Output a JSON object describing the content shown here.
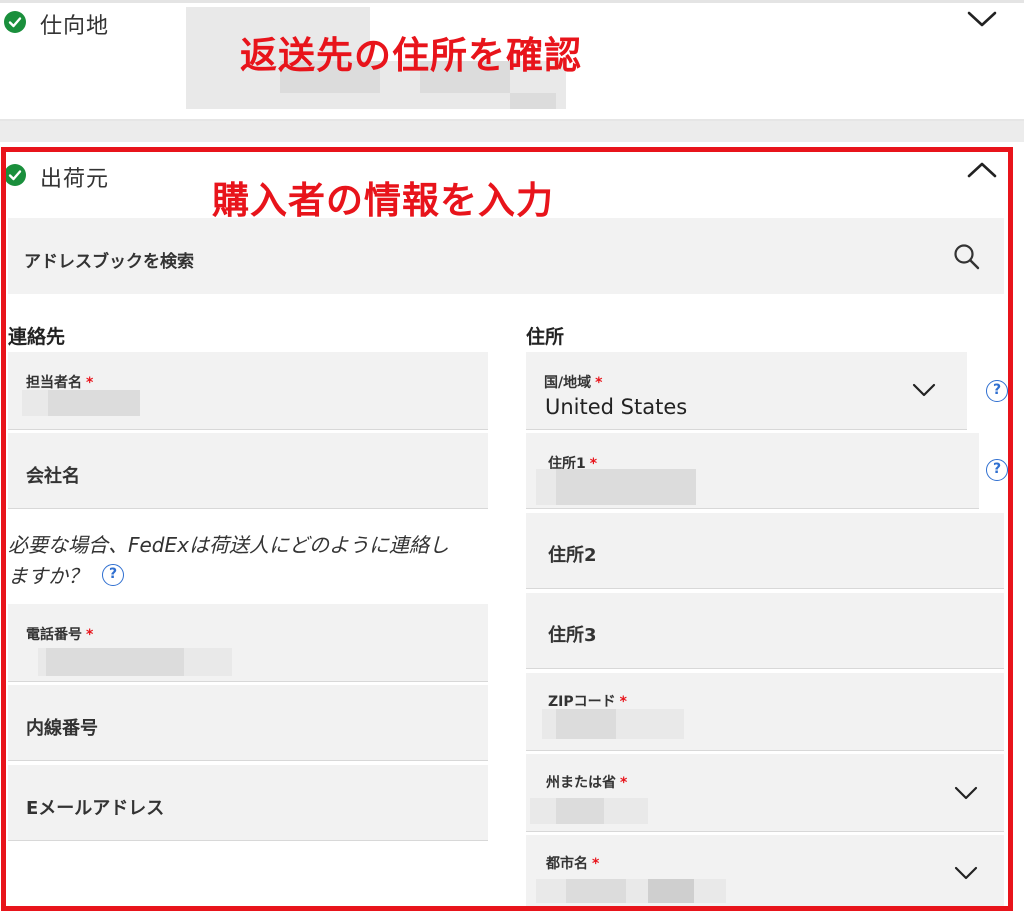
{
  "destination": {
    "label": "仕向地",
    "annotation": "返送先の住所を確認"
  },
  "origin": {
    "label": "出荷元",
    "annotation": "購入者の情報を入力",
    "address_book_search": "アドレスブックを検索"
  },
  "contact": {
    "heading": "連絡先",
    "name_label": "担当者名",
    "company_label": "会社名",
    "help_text": "必要な場合、FedExは荷送人にどのように連絡しますか？",
    "help_text_line1": "必要な場合、FedExは荷送人にどのように連絡し",
    "help_text_line2": "ますか？",
    "phone_label": "電話番号",
    "extension_label": "内線番号",
    "email_label": "Eメールアドレス"
  },
  "address": {
    "heading": "住所",
    "country_label": "国/地域",
    "country_value": "United States",
    "address1_label": "住所1",
    "address2_label": "住所2",
    "address3_label": "住所3",
    "zip_label": "ZIPコード",
    "state_label": "州または省",
    "city_label": "都市名"
  },
  "required_marker": "*",
  "help_glyph": "?",
  "icons": {
    "check": "check-circle-icon",
    "chevron_down": "chevron-down-icon",
    "chevron_up": "chevron-up-icon",
    "search": "search-icon",
    "help": "help-icon"
  },
  "colors": {
    "annotation_red": "#e8141b",
    "check_green": "#1a8f3c",
    "help_blue": "#2f6fd0",
    "field_bg": "#f2f2f2"
  }
}
